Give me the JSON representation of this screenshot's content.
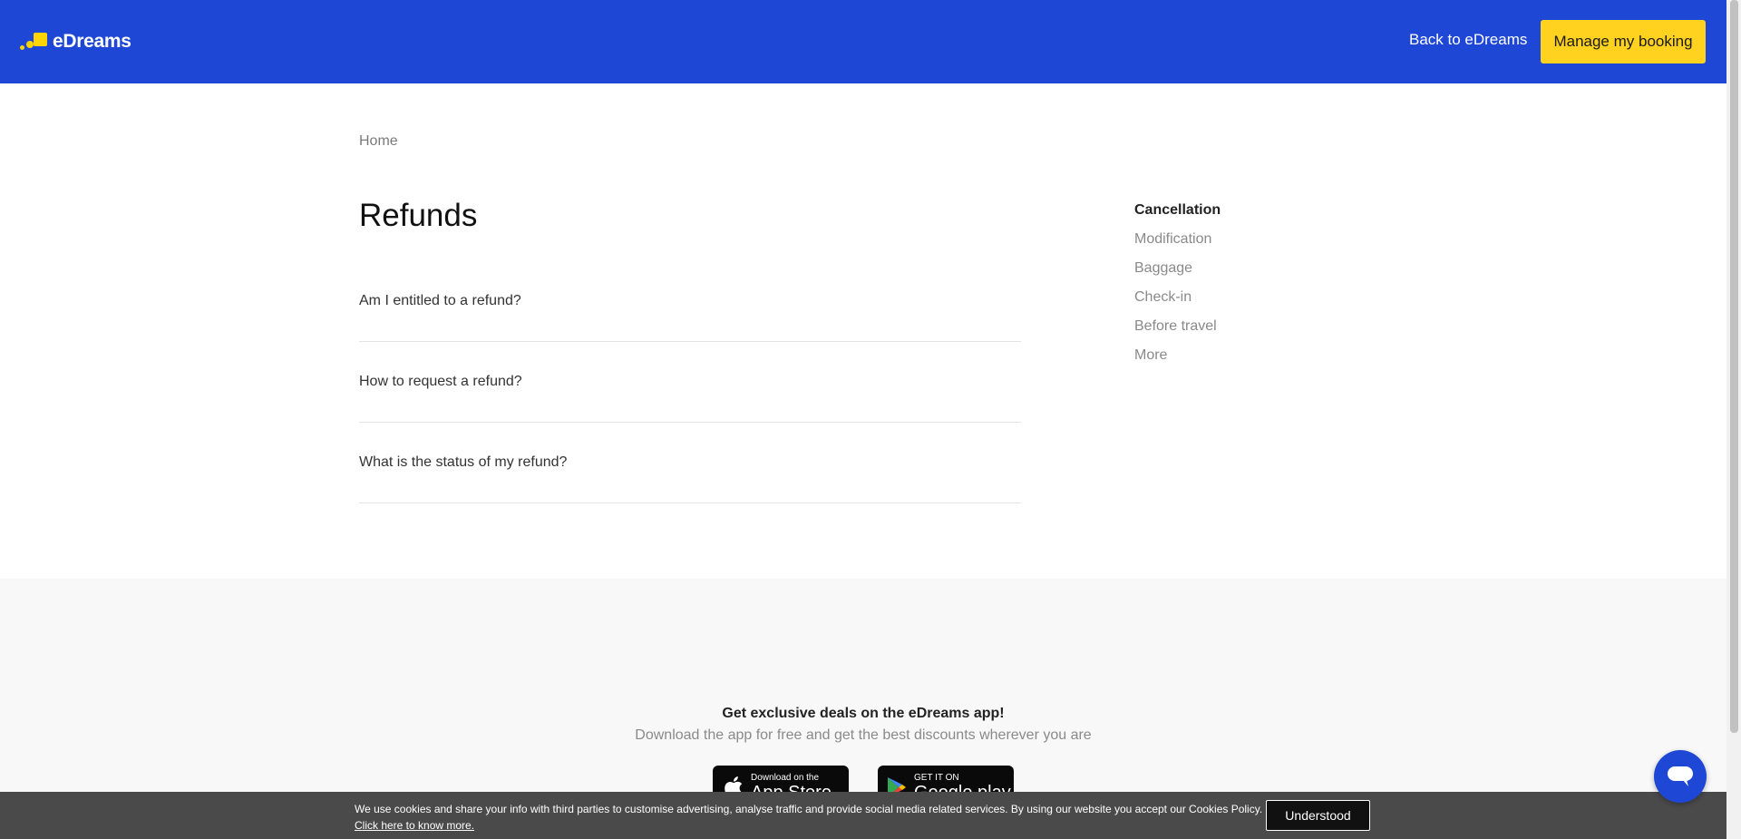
{
  "header": {
    "logo_text": "eDreams",
    "back_link": "Back to eDreams",
    "manage_button": "Manage my booking"
  },
  "breadcrumb": {
    "home": "Home"
  },
  "main": {
    "title": "Refunds",
    "faqs": [
      "Am I entitled to a refund?",
      "How to request a refund?",
      "What is the status of my refund?"
    ]
  },
  "side_nav": {
    "items": [
      {
        "label": "Cancellation",
        "active": true
      },
      {
        "label": "Modification",
        "active": false
      },
      {
        "label": "Baggage",
        "active": false
      },
      {
        "label": "Check-in",
        "active": false
      },
      {
        "label": "Before travel",
        "active": false
      },
      {
        "label": "More",
        "active": false
      }
    ]
  },
  "promo": {
    "title": "Get exclusive deals on the eDreams app!",
    "subtitle": "Download the app for free and get the best discounts wherever you are",
    "app_store": {
      "small": "Download on the",
      "big": "App Store",
      "icon": "apple-icon"
    },
    "google_play": {
      "small": "GET IT ON",
      "big": "Google play",
      "icon": "play-icon"
    }
  },
  "cookie": {
    "text": "We use cookies and share your info with third parties to customise advertising, analyse traffic and provide social media related services. By using our website you accept our Cookies Policy.",
    "link": "Click here to know more.",
    "button": "Understood"
  },
  "chat": {
    "icon": "chat-bubble-icon"
  },
  "colors": {
    "header_bg": "#1f47d6",
    "accent_yellow": "#ffd21f",
    "cookie_bg": "#4a4a4a"
  }
}
